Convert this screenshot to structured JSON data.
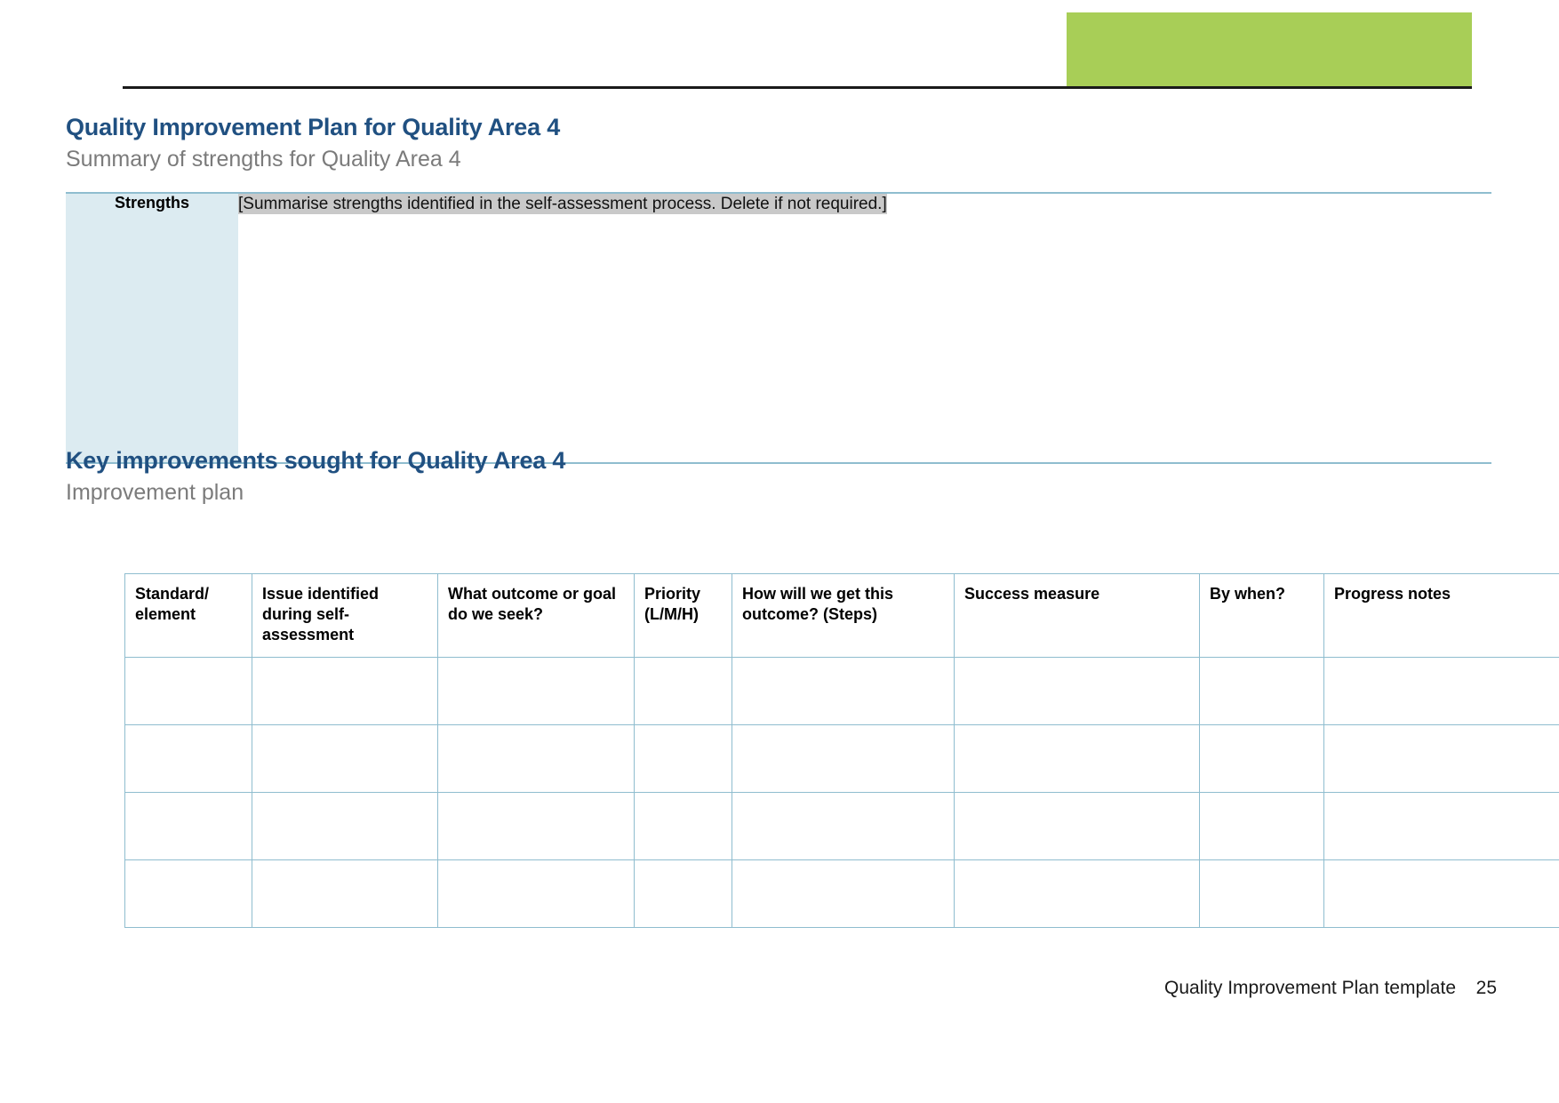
{
  "document": {
    "header": {
      "accent_block_color": "#a8ce57",
      "rule_color": "#1a1a1a"
    },
    "footer": {
      "label": "Quality Improvement Plan template",
      "page_number": "25"
    }
  },
  "sections": [
    {
      "title": "Quality Improvement Plan for Quality Area 4",
      "subtitle": "Summary of strengths for Quality Area 4"
    },
    {
      "title": "Key improvements sought for Quality Area 4",
      "subtitle": "Improvement plan"
    }
  ],
  "strengths_table": {
    "row_label": "Strengths",
    "placeholder": "[Summarise strengths identified in the self-assessment process. Delete if not required.]",
    "label_background": "#dcebf1",
    "placeholder_highlight": "#c9c9c9"
  },
  "improvement_table": {
    "columns": [
      "Standard/ element",
      "Issue identified during self-assessment",
      "What outcome or goal do we seek?",
      "Priority (L/M/H)",
      "How will we get this outcome? (Steps)",
      "Success measure",
      "By when?",
      "Progress notes"
    ],
    "rows": [
      [
        "",
        "",
        "",
        "",
        "",
        "",
        "",
        ""
      ],
      [
        "",
        "",
        "",
        "",
        "",
        "",
        "",
        ""
      ],
      [
        "",
        "",
        "",
        "",
        "",
        "",
        "",
        ""
      ],
      [
        "",
        "",
        "",
        "",
        "",
        "",
        "",
        ""
      ]
    ],
    "border_color": "#8fbdcf"
  },
  "theme": {
    "heading_color": "#205081",
    "subheading_color": "#7b7b7b"
  }
}
